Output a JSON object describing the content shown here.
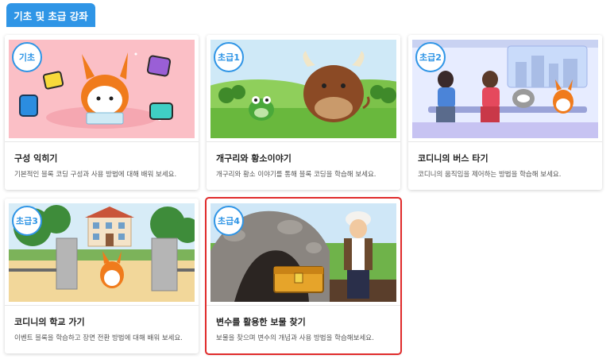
{
  "section": {
    "tab_label": "기초 및 초급 강좌"
  },
  "courses": [
    {
      "badge": "기초",
      "title": "구성 익히기",
      "description": "기본적인 블록 코딩 구성과 사용 방법에 대해 배워 보세요."
    },
    {
      "badge": "초급1",
      "title": "개구리와 황소이야기",
      "description": "개구리와 황소 이야기를 통해 블록 코딩을 학습해 보세요."
    },
    {
      "badge": "초급2",
      "title": "코디니의 버스 타기",
      "description": "코디니의 움직임을 제어하는 방법을 학습해 보세요."
    },
    {
      "badge": "초급3",
      "title": "코디니의 학교 가기",
      "description": "이벤트 블록을 학습하고 장면 전환 방법에 대해 배워 보세요."
    },
    {
      "badge": "초급4",
      "title": "변수를 활용한 보물 찾기",
      "description": "보물을 찾으며 변수의 개념과 사용 방법을 학습해보세요."
    }
  ],
  "colors": {
    "accent": "#2f95e6",
    "selected_border": "#e02b2b"
  }
}
